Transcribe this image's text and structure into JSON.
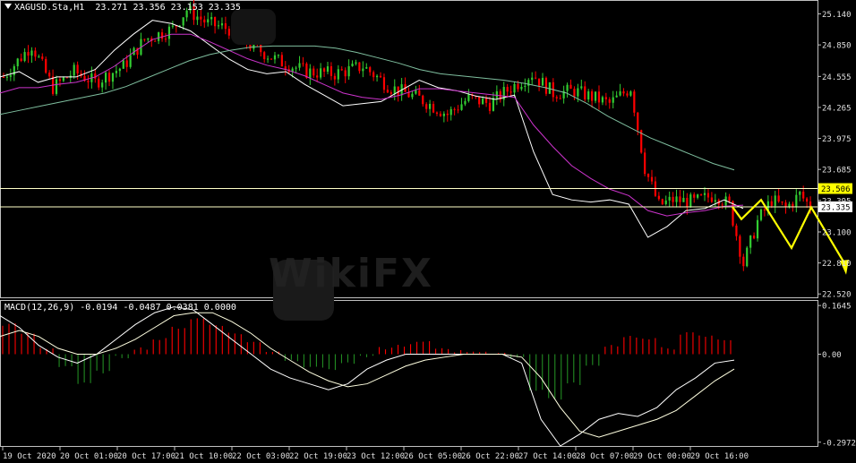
{
  "header": {
    "symbol": "XAGUSD.Sta,H1",
    "ohlc": "23.271 23.356 23.153 23.335"
  },
  "macd_header": {
    "label": "MACD(12,26,9) -0.0194 -0.0487 0.0381 0.0000"
  },
  "watermark": "WikiFX",
  "colors": {
    "background": "#000000",
    "bull_candle": "#32cd32",
    "bear_candle": "#ff0000",
    "ma_fast": "#ffffff",
    "ma_mid": "#cc33cc",
    "ma_slow": "#7fbf9f",
    "horizontal_line": "#ffffc8",
    "projection": "#ffff00",
    "macd_pos": "#ff0000",
    "macd_neg": "#228b22",
    "macd_line": "#ffffff",
    "signal_line": "#ffffe0",
    "price_tag": "#ffff00"
  },
  "chart_data": [
    {
      "type": "candlestick",
      "title": "XAGUSD.Sta,H1",
      "y_ticks": [
        "25.140",
        "24.850",
        "24.555",
        "24.265",
        "23.975",
        "23.685",
        "23.395",
        "23.100",
        "22.810",
        "22.520"
      ],
      "ylim": [
        22.48,
        25.27
      ],
      "x_ticks": [
        "19 Oct 2020",
        "20 Oct 01:00",
        "20 Oct 17:00",
        "21 Oct 10:00",
        "22 Oct 03:00",
        "22 Oct 19:00",
        "23 Oct 12:00",
        "26 Oct 05:00",
        "26 Oct 22:00",
        "27 Oct 14:00",
        "28 Oct 07:00",
        "29 Oct 00:00",
        "29 Oct 16:00"
      ],
      "horizontal_lines": [
        23.506,
        23.335
      ],
      "price_tags": [
        "23.506",
        "23.335"
      ],
      "close_path": [
        [
          0,
          24.55
        ],
        [
          8,
          24.85
        ],
        [
          14,
          24.45
        ],
        [
          20,
          24.6
        ],
        [
          26,
          24.5
        ],
        [
          34,
          24.65
        ],
        [
          40,
          24.9
        ],
        [
          48,
          25.0
        ],
        [
          52,
          25.18
        ],
        [
          58,
          25.05
        ],
        [
          64,
          25.0
        ],
        [
          70,
          24.85
        ],
        [
          78,
          24.7
        ],
        [
          86,
          24.6
        ],
        [
          94,
          24.58
        ],
        [
          102,
          24.65
        ],
        [
          110,
          24.45
        ],
        [
          118,
          24.35
        ],
        [
          126,
          24.2
        ],
        [
          132,
          24.35
        ],
        [
          138,
          24.3
        ],
        [
          144,
          24.45
        ],
        [
          150,
          24.58
        ],
        [
          156,
          24.4
        ],
        [
          162,
          24.42
        ],
        [
          168,
          24.35
        ],
        [
          172,
          24.3
        ],
        [
          178,
          24.45
        ],
        [
          182,
          23.7
        ],
        [
          186,
          23.35
        ],
        [
          190,
          23.4
        ],
        [
          196,
          23.38
        ],
        [
          202,
          23.45
        ],
        [
          206,
          23.35
        ],
        [
          210,
          22.8
        ],
        [
          214,
          23.2
        ],
        [
          218,
          23.4
        ],
        [
          222,
          23.32
        ],
        [
          226,
          23.45
        ],
        [
          230,
          23.3
        ]
      ],
      "projection": [
        23.335,
        23.22,
        23.4,
        22.95,
        23.33,
        22.78
      ],
      "series": [
        {
          "name": "MA fast",
          "values": [
            24.55,
            24.6,
            24.5,
            24.55,
            24.55,
            24.62,
            24.8,
            24.95,
            25.08,
            25.05,
            24.98,
            24.85,
            24.72,
            24.62,
            24.58,
            24.6,
            24.48,
            24.38,
            24.28,
            24.3,
            24.32,
            24.42,
            24.52,
            24.45,
            24.42,
            24.37,
            24.34,
            24.38,
            23.85,
            23.45,
            23.4,
            23.38,
            23.4,
            23.36,
            23.05,
            23.15,
            23.3,
            23.32,
            23.4,
            23.32
          ]
        },
        {
          "name": "MA mid",
          "values": [
            24.4,
            24.45,
            24.45,
            24.48,
            24.5,
            24.55,
            24.65,
            24.78,
            24.9,
            24.95,
            24.95,
            24.88,
            24.8,
            24.72,
            24.66,
            24.62,
            24.56,
            24.48,
            24.4,
            24.36,
            24.34,
            24.38,
            24.44,
            24.44,
            24.42,
            24.4,
            24.38,
            24.36,
            24.1,
            23.9,
            23.72,
            23.6,
            23.5,
            23.44,
            23.3,
            23.25,
            23.28,
            23.3,
            23.34,
            23.35
          ]
        },
        {
          "name": "MA slow",
          "values": [
            24.2,
            24.24,
            24.28,
            24.32,
            24.36,
            24.4,
            24.46,
            24.54,
            24.62,
            24.7,
            24.76,
            24.8,
            24.83,
            24.84,
            24.84,
            24.84,
            24.82,
            24.78,
            24.73,
            24.68,
            24.62,
            24.58,
            24.56,
            24.54,
            24.52,
            24.49,
            24.45,
            24.4,
            24.3,
            24.18,
            24.08,
            23.98,
            23.9,
            23.82,
            23.74,
            23.68
          ]
        }
      ]
    },
    {
      "type": "bar",
      "title": "MACD(12,26,9)",
      "y_ticks": [
        "0.1645",
        "0.00",
        "-0.2972"
      ],
      "ylim": [
        -0.31,
        0.18
      ],
      "histogram": [
        0.1,
        0.07,
        0.02,
        -0.04,
        -0.1,
        -0.06,
        -0.01,
        0.02,
        0.05,
        0.09,
        0.12,
        0.1,
        0.07,
        0.04,
        0.01,
        -0.02,
        -0.04,
        -0.05,
        -0.03,
        -0.01,
        0.02,
        0.03,
        0.04,
        0.02,
        0.01,
        0.01,
        0.0,
        -0.01,
        -0.12,
        -0.15,
        -0.1,
        -0.04,
        0.03,
        0.06,
        0.05,
        0.02,
        0.07,
        0.06,
        0.05
      ],
      "series": [
        {
          "name": "MACD",
          "values": [
            0.13,
            0.09,
            0.03,
            -0.01,
            -0.03,
            0.0,
            0.05,
            0.1,
            0.14,
            0.16,
            0.15,
            0.1,
            0.05,
            0.0,
            -0.05,
            -0.08,
            -0.1,
            -0.12,
            -0.1,
            -0.05,
            -0.02,
            0.0,
            0.0,
            0.0,
            0.0,
            0.0,
            0.0,
            -0.03,
            -0.22,
            -0.31,
            -0.27,
            -0.22,
            -0.2,
            -0.21,
            -0.18,
            -0.12,
            -0.08,
            -0.03,
            -0.02
          ]
        },
        {
          "name": "Signal",
          "values": [
            0.06,
            0.08,
            0.06,
            0.02,
            0.0,
            0.0,
            0.02,
            0.05,
            0.09,
            0.13,
            0.14,
            0.14,
            0.11,
            0.07,
            0.02,
            -0.02,
            -0.06,
            -0.09,
            -0.11,
            -0.1,
            -0.07,
            -0.04,
            -0.02,
            -0.01,
            0.0,
            0.0,
            0.0,
            -0.01,
            -0.08,
            -0.18,
            -0.26,
            -0.28,
            -0.26,
            -0.24,
            -0.22,
            -0.19,
            -0.14,
            -0.09,
            -0.05
          ]
        }
      ]
    }
  ]
}
